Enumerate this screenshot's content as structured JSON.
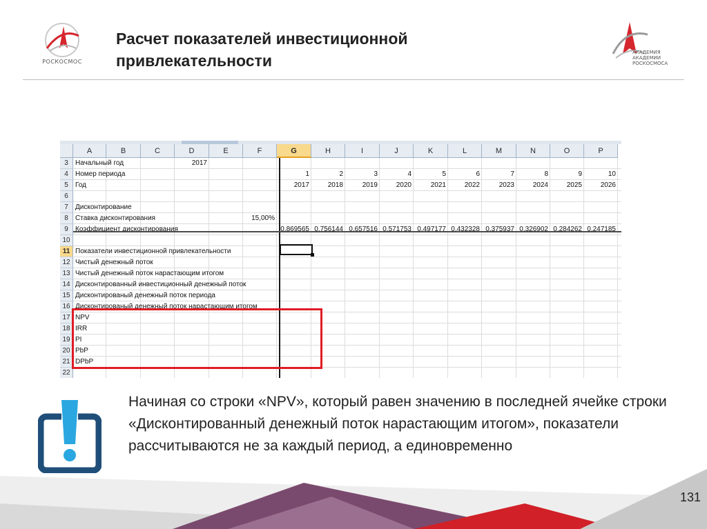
{
  "slide": {
    "title_line1": "Расчет показателей инвестиционной",
    "title_line2": "привлекательности",
    "page_number": "131",
    "note": "Начиная со строки «NPV», который равен значению в последней ячейке строки «Дисконтированный денежный поток нарастающим итогом», показатели рассчитываются не за каждый период, а единовременно"
  },
  "logos": {
    "left_wordmark": "РОСКОСМОС",
    "right_caption": "АКАДЕМИЯ\nАКАДЕМИИ\nРОСКОСМОСА"
  },
  "sheet": {
    "columns": [
      "A",
      "B",
      "C",
      "D",
      "E",
      "F",
      "G",
      "H",
      "I",
      "J",
      "K",
      "L",
      "M",
      "N",
      "O",
      "P"
    ],
    "active_column": "G",
    "active_row": "11",
    "rows": [
      {
        "num": "3",
        "label": "Начальный год",
        "d": "2017"
      },
      {
        "num": "4",
        "label": "Номер периода",
        "values": [
          "1",
          "2",
          "3",
          "4",
          "5",
          "6",
          "7",
          "8",
          "9",
          "10"
        ]
      },
      {
        "num": "5",
        "label": "Год",
        "values": [
          "2017",
          "2018",
          "2019",
          "2020",
          "2021",
          "2022",
          "2023",
          "2024",
          "2025",
          "2026"
        ]
      },
      {
        "num": "6",
        "label": ""
      },
      {
        "num": "7",
        "label": "Дисконтирование"
      },
      {
        "num": "8",
        "label": "Ставка дисконтирования",
        "f": "15,00%"
      },
      {
        "num": "9",
        "label": "Коэффициент дисконтирования",
        "values": [
          "0,869565",
          "0,756144",
          "0,657516",
          "0,571753",
          "0,497177",
          "0,432328",
          "0,375937",
          "0,326902",
          "0,284262",
          "0,247185"
        ]
      },
      {
        "num": "10",
        "label": ""
      },
      {
        "num": "11",
        "label": "Показатели инвестиционной привлекательности"
      },
      {
        "num": "12",
        "label": "Чистый денежный поток"
      },
      {
        "num": "13",
        "label": "Чистый денежный поток нарастающим итогом"
      },
      {
        "num": "14",
        "label": "Дисконтированный инвестиционный денежный поток"
      },
      {
        "num": "15",
        "label": "Дисконтированый денежный поток периода"
      },
      {
        "num": "16",
        "label": "Дисконтированый денежный поток нарастающим итогом"
      },
      {
        "num": "17",
        "label": "NPV"
      },
      {
        "num": "18",
        "label": "IRR"
      },
      {
        "num": "19",
        "label": "PI"
      },
      {
        "num": "20",
        "label": "PbP"
      },
      {
        "num": "21",
        "label": "DPbP"
      },
      {
        "num": "22",
        "label": ""
      }
    ]
  },
  "colors": {
    "highlight": "#e01b24",
    "logo_red": "#d6262e",
    "icon_blue": "#1f4e79",
    "footer_purple": "#7a4a6e",
    "footer_red": "#d12027"
  }
}
